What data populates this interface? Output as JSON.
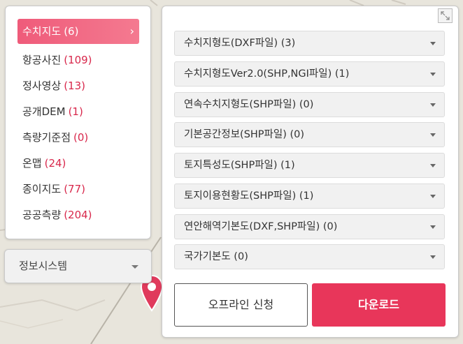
{
  "categories": [
    {
      "name": "수치지도",
      "count": "(6)"
    },
    {
      "name": "항공사진",
      "count": "(109)"
    },
    {
      "name": "정사영상",
      "count": "(13)"
    },
    {
      "name": "공개DEM",
      "count": "(1)"
    },
    {
      "name": "측량기준점",
      "count": "(0)"
    },
    {
      "name": "온맵",
      "count": "(24)"
    },
    {
      "name": "종이지도",
      "count": "(77)"
    },
    {
      "name": "공공측량",
      "count": "(204)"
    }
  ],
  "info_select": {
    "label": "정보시스템"
  },
  "downloads": [
    {
      "label": "수치지형도(DXF파일) (3)"
    },
    {
      "label": "수치지형도Ver2.0(SHP,NGI파일) (1)"
    },
    {
      "label": "연속수치지형도(SHP파일) (0)"
    },
    {
      "label": "기본공간정보(SHP파일) (0)"
    },
    {
      "label": "토지특성도(SHP파일) (1)"
    },
    {
      "label": "토지이용현황도(SHP파일) (1)"
    },
    {
      "label": "연안해역기본도(DXF,SHP파일) (0)"
    },
    {
      "label": "국가기본도 (0)"
    }
  ],
  "buttons": {
    "offline": "오프라인 신청",
    "download": "다운로드"
  },
  "colors": {
    "accent": "#e8365a",
    "active_tab": "#ef5b7a",
    "count": "#d8274b"
  }
}
